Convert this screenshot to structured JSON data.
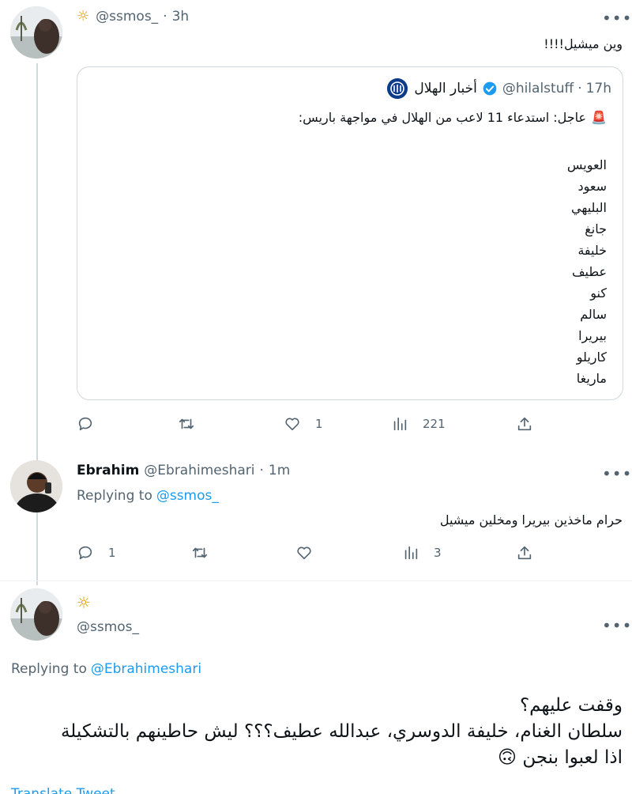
{
  "tweet1": {
    "author_name": "☼",
    "handle": "@ssmos_",
    "dot": "·",
    "time": "3h",
    "text": "وين ميشيل!!!!",
    "quote": {
      "author_name": "أخبار الهلال",
      "handle": "@hilalstuff",
      "dot": "·",
      "time": "17h",
      "headline": "عاجل: استدعاء 11 لاعب من الهلال في مواجهة باريس:",
      "alert_emoji": "🚨",
      "players": [
        "العويس",
        "سعود",
        "البليهي",
        "جانغ",
        "خليفة",
        "عطيف",
        "كنو",
        "سالم",
        "بيريرا",
        "كاريلو",
        "ماريغا"
      ]
    },
    "actions": {
      "reply_count": "",
      "retweet_count": "",
      "like_count": "1",
      "view_count": "221"
    }
  },
  "tweet2": {
    "author_name": "Ebrahim",
    "handle": "@Ebrahimeshari",
    "dot": "·",
    "time": "1m",
    "replying_prefix": "Replying to",
    "replying_to": "@ssmos_",
    "text": "حرام ماخذين بيريرا ومخلين ميشيل",
    "actions": {
      "reply_count": "1",
      "retweet_count": "",
      "like_count": "",
      "view_count": "3"
    }
  },
  "tweet3": {
    "author_name": "☼",
    "handle": "@ssmos_",
    "replying_prefix": "Replying to",
    "replying_to": "@Ebrahimeshari",
    "line1": "وقفت عليهم؟",
    "line2": "سلطان الغنام، خليفة الدوسري، عبدالله عطيف؟؟؟ ليش حاطينهم بالتشكيلة",
    "line3": "اذا لعبوا بنجن",
    "emoji": "🙃",
    "translate": "Translate Tweet"
  },
  "icons": [
    "more-icon",
    "verified-badge-icon",
    "reply-icon",
    "retweet-icon",
    "like-icon",
    "views-icon",
    "share-icon"
  ],
  "colors": {
    "link": "#1d9bf0",
    "muted": "#536471",
    "border": "#cfd9de",
    "verified": "#1d9bf0"
  }
}
